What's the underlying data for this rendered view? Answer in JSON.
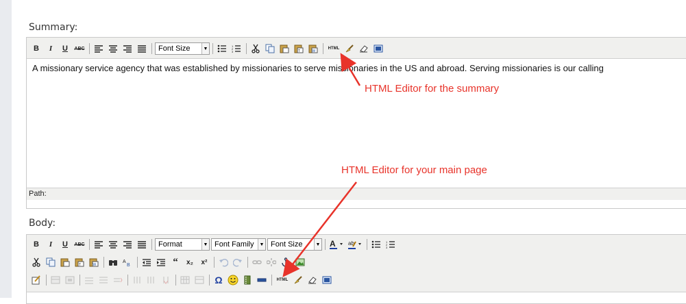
{
  "summary": {
    "label": "Summary:",
    "font_size_placeholder": "Font Size",
    "content": "A missionary service agency that was established by missionaries to serve missionaries in the US and abroad. Serving missionaries is our calling",
    "path_label": "Path:"
  },
  "body": {
    "label": "Body:",
    "format_placeholder": "Format",
    "font_family_placeholder": "Font Family",
    "font_size_placeholder": "Font Size"
  },
  "toolbar_text": {
    "bold": "B",
    "italic": "I",
    "underline": "U",
    "strikethrough": "ABC",
    "html": "HTML",
    "omega": "Ω",
    "subscript": "x₂",
    "superscript": "x²",
    "quote": "“"
  },
  "annotations": {
    "summary_note": "HTML Editor for the summary",
    "body_note": "HTML Editor for your main page"
  },
  "colors": {
    "annotation": "#e8332a",
    "toolbar_bg": "#f0f0ee",
    "gutter": "#e9ebef"
  }
}
